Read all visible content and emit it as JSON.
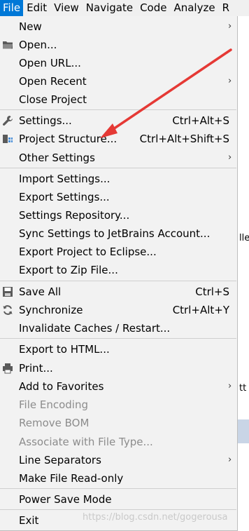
{
  "menubar": {
    "items": [
      "File",
      "Edit",
      "View",
      "Navigate",
      "Code",
      "Analyze",
      "R"
    ]
  },
  "background": {
    "fragment_1": "lle",
    "fragment_2": "tt"
  },
  "menu": {
    "items": [
      {
        "label": "New",
        "shortcut": "",
        "submenu": true,
        "icon": "",
        "disabled": false
      },
      {
        "label": "Open...",
        "shortcut": "",
        "submenu": false,
        "icon": "folder-icon",
        "disabled": false
      },
      {
        "label": "Open URL...",
        "shortcut": "",
        "submenu": false,
        "icon": "",
        "disabled": false
      },
      {
        "label": "Open Recent",
        "shortcut": "",
        "submenu": true,
        "icon": "",
        "disabled": false
      },
      {
        "label": "Close Project",
        "shortcut": "",
        "submenu": false,
        "icon": "",
        "disabled": false
      },
      {
        "label": "Settings...",
        "shortcut": "Ctrl+Alt+S",
        "submenu": false,
        "icon": "wrench-icon",
        "disabled": false
      },
      {
        "label": "Project Structure...",
        "shortcut": "Ctrl+Alt+Shift+S",
        "submenu": false,
        "icon": "project-structure-icon",
        "disabled": false
      },
      {
        "label": "Other Settings",
        "shortcut": "",
        "submenu": true,
        "icon": "",
        "disabled": false
      },
      {
        "label": "Import Settings...",
        "shortcut": "",
        "submenu": false,
        "icon": "",
        "disabled": false
      },
      {
        "label": "Export Settings...",
        "shortcut": "",
        "submenu": false,
        "icon": "",
        "disabled": false
      },
      {
        "label": "Settings Repository...",
        "shortcut": "",
        "submenu": false,
        "icon": "",
        "disabled": false
      },
      {
        "label": "Sync Settings to JetBrains Account...",
        "shortcut": "",
        "submenu": false,
        "icon": "",
        "disabled": false
      },
      {
        "label": "Export Project to Eclipse...",
        "shortcut": "",
        "submenu": false,
        "icon": "",
        "disabled": false
      },
      {
        "label": "Export to Zip File...",
        "shortcut": "",
        "submenu": false,
        "icon": "",
        "disabled": false
      },
      {
        "label": "Save All",
        "shortcut": "Ctrl+S",
        "submenu": false,
        "icon": "save-icon",
        "disabled": false
      },
      {
        "label": "Synchronize",
        "shortcut": "Ctrl+Alt+Y",
        "submenu": false,
        "icon": "sync-icon",
        "disabled": false
      },
      {
        "label": "Invalidate Caches / Restart...",
        "shortcut": "",
        "submenu": false,
        "icon": "",
        "disabled": false
      },
      {
        "label": "Export to HTML...",
        "shortcut": "",
        "submenu": false,
        "icon": "",
        "disabled": false
      },
      {
        "label": "Print...",
        "shortcut": "",
        "submenu": false,
        "icon": "print-icon",
        "disabled": false
      },
      {
        "label": "Add to Favorites",
        "shortcut": "",
        "submenu": true,
        "icon": "",
        "disabled": false
      },
      {
        "label": "File Encoding",
        "shortcut": "",
        "submenu": false,
        "icon": "",
        "disabled": true
      },
      {
        "label": "Remove BOM",
        "shortcut": "",
        "submenu": false,
        "icon": "",
        "disabled": true
      },
      {
        "label": "Associate with File Type...",
        "shortcut": "",
        "submenu": false,
        "icon": "",
        "disabled": true
      },
      {
        "label": "Line Separators",
        "shortcut": "",
        "submenu": true,
        "icon": "",
        "disabled": false
      },
      {
        "label": "Make File Read-only",
        "shortcut": "",
        "submenu": false,
        "icon": "",
        "disabled": false
      },
      {
        "label": "Power Save Mode",
        "shortcut": "",
        "submenu": false,
        "icon": "",
        "disabled": false
      },
      {
        "label": "Exit",
        "shortcut": "",
        "submenu": false,
        "icon": "",
        "disabled": false
      }
    ]
  },
  "watermark": "https://blog.csdn.net/gogerousa",
  "colors": {
    "menubar_active": "#0078d7",
    "menu_bg": "#f2f2f2",
    "disabled_text": "#8c8c8c",
    "annotation_arrow": "#e53935"
  }
}
